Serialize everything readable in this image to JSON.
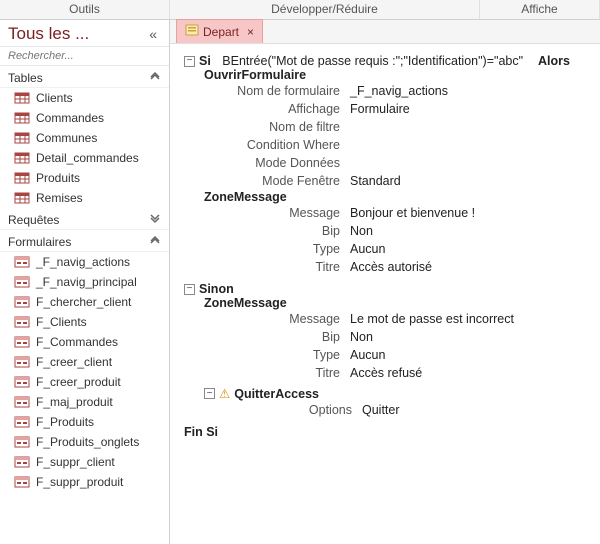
{
  "ribbon": {
    "tools": "Outils",
    "expand": "Développer/Réduire",
    "show": "Affiche"
  },
  "sidebar": {
    "title": "Tous les ...",
    "search_placeholder": "Rechercher...",
    "groups": {
      "tables": {
        "label": "Tables",
        "items": [
          "Clients",
          "Commandes",
          "Communes",
          "Detail_commandes",
          "Produits",
          "Remises"
        ]
      },
      "requetes": {
        "label": "Requêtes"
      },
      "formulaires": {
        "label": "Formulaires",
        "items": [
          "_F_navig_actions",
          "_F_navig_principal",
          "F_chercher_client",
          "F_Clients",
          "F_Commandes",
          "F_creer_client",
          "F_creer_produit",
          "F_maj_produit",
          "F_Produits",
          "F_Produits_onglets",
          "F_suppr_client",
          "F_suppr_produit"
        ]
      }
    }
  },
  "tab": {
    "label": "Depart"
  },
  "macro": {
    "si": "Si",
    "alors": "Alors",
    "expr": "BEntrée(\"Mot de passe requis :\";\"Identification\")=\"abc\"",
    "ouvrir": "OuvrirFormulaire",
    "fields": {
      "nom_form": {
        "l": "Nom de formulaire",
        "v": "_F_navig_actions"
      },
      "affichage": {
        "l": "Affichage",
        "v": "Formulaire"
      },
      "nom_filtre": {
        "l": "Nom de filtre",
        "v": ""
      },
      "cond_where": {
        "l": "Condition Where",
        "v": ""
      },
      "mode_donnees": {
        "l": "Mode Données",
        "v": ""
      },
      "mode_fenetre": {
        "l": "Mode Fenêtre",
        "v": "Standard"
      }
    },
    "zone1": "ZoneMessage",
    "z1": {
      "message": {
        "l": "Message",
        "v": "Bonjour et bienvenue !"
      },
      "bip": {
        "l": "Bip",
        "v": "Non"
      },
      "type": {
        "l": "Type",
        "v": "Aucun"
      },
      "titre": {
        "l": "Titre",
        "v": "Accès autorisé"
      }
    },
    "sinon": "Sinon",
    "zone2": "ZoneMessage",
    "z2": {
      "message": {
        "l": "Message",
        "v": "Le mot de passe est incorrect"
      },
      "bip": {
        "l": "Bip",
        "v": "Non"
      },
      "type": {
        "l": "Type",
        "v": "Aucun"
      },
      "titre": {
        "l": "Titre",
        "v": "Accès refusé"
      }
    },
    "quitter": "QuitterAccess",
    "quitter_opt": {
      "l": "Options",
      "v": "Quitter"
    },
    "finsi": "Fin Si"
  }
}
